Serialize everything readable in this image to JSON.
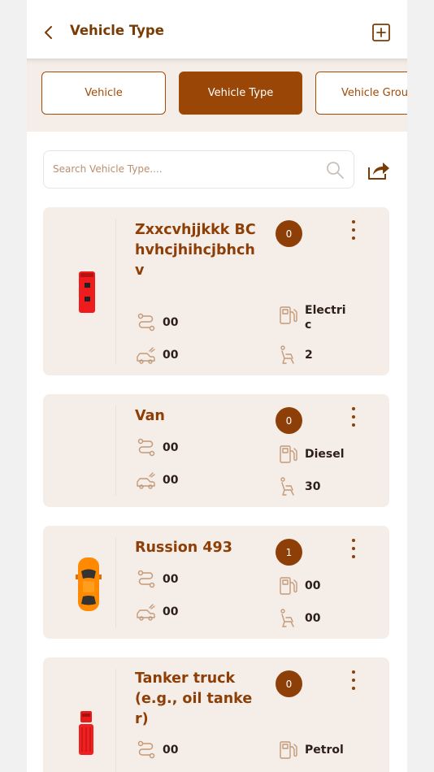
{
  "header": {
    "title": "Vehicle Type"
  },
  "tabs": [
    {
      "label": "Vehicle",
      "active": false
    },
    {
      "label": "Vehicle Type",
      "active": true
    },
    {
      "label": "Vehicle Group",
      "active": false
    }
  ],
  "search": {
    "placeholder": "Search Vehicle Type...."
  },
  "colors": {
    "brand": "#8d3f07",
    "tab_active": "#9a4607",
    "card_bg": "#f5ede7",
    "icon": "#c49a78"
  },
  "icons": {
    "back": "chevron-left-icon",
    "add": "plus-square-icon",
    "search": "search-icon",
    "share": "share-icon",
    "route": "route-icon",
    "car": "car-icon",
    "fuel": "fuel-pump-icon",
    "seat": "seat-icon",
    "more": "kebab-menu-icon"
  },
  "cards": [
    {
      "name": "Zxxcvhjjkkk BC hvhcjhihcjbhchv",
      "badge": "0",
      "stat1": "00",
      "stat2": "00",
      "fuel": "Electric",
      "seats": "2",
      "image": "red-bus"
    },
    {
      "name": "Van",
      "badge": "0",
      "stat1": "00",
      "stat2": "00",
      "fuel": "Diesel",
      "seats": "30",
      "image": "none"
    },
    {
      "name": "Russion 493",
      "badge": "1",
      "stat1": "00",
      "stat2": "00",
      "fuel": "00",
      "seats": "00",
      "image": "orange-car"
    },
    {
      "name": "Tanker truck (e.g., oil tanker)",
      "badge": "0",
      "stat1": "00",
      "stat2": "",
      "fuel": "Petrol",
      "seats": "",
      "image": "red-tanker"
    }
  ]
}
